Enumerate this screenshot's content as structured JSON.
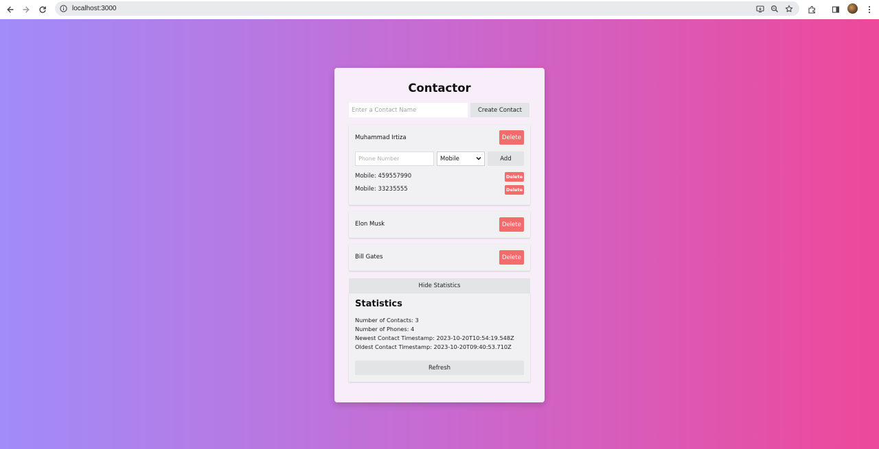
{
  "browser": {
    "url": "localhost:3000",
    "icons": [
      "back-icon",
      "forward-icon",
      "reload-icon",
      "info-icon",
      "install-icon",
      "zoom-icon",
      "bookmark-star-icon",
      "extensions-icon",
      "side-panel-icon",
      "profile-avatar",
      "menu-icon"
    ]
  },
  "colors": {
    "gradient_start": "#a18cf9",
    "gradient_mid": "#c86ad1",
    "gradient_end": "#ee4899",
    "delete_red": "#f36c6c",
    "card_bg": "#f7eef9"
  },
  "app": {
    "title": "Contactor",
    "create": {
      "placeholder": "Enter a Contact Name",
      "button": "Create Contact"
    },
    "delete_label": "Delete",
    "contacts": [
      {
        "name": "Muhammad Irtiza",
        "phone_placeholder": "Phone Number",
        "type_selected": "Mobile",
        "add_label": "Add",
        "phones": [
          {
            "text": "Mobile: 459557990"
          },
          {
            "text": "Mobile: 33235555"
          }
        ]
      },
      {
        "name": "Elon Musk"
      },
      {
        "name": "Bill Gates"
      }
    ],
    "stats_toggle": "Hide Statistics",
    "stats": {
      "title": "Statistics",
      "contacts_line": "Number of Contacts: 3",
      "phones_line": "Number of Phones: 4",
      "newest_line": "Newest Contact Timestamp: 2023-10-20T10:54:19.548Z",
      "oldest_line": "Oldest Contact Timestamp: 2023-10-20T09:40:53.710Z",
      "refresh": "Refresh"
    }
  }
}
